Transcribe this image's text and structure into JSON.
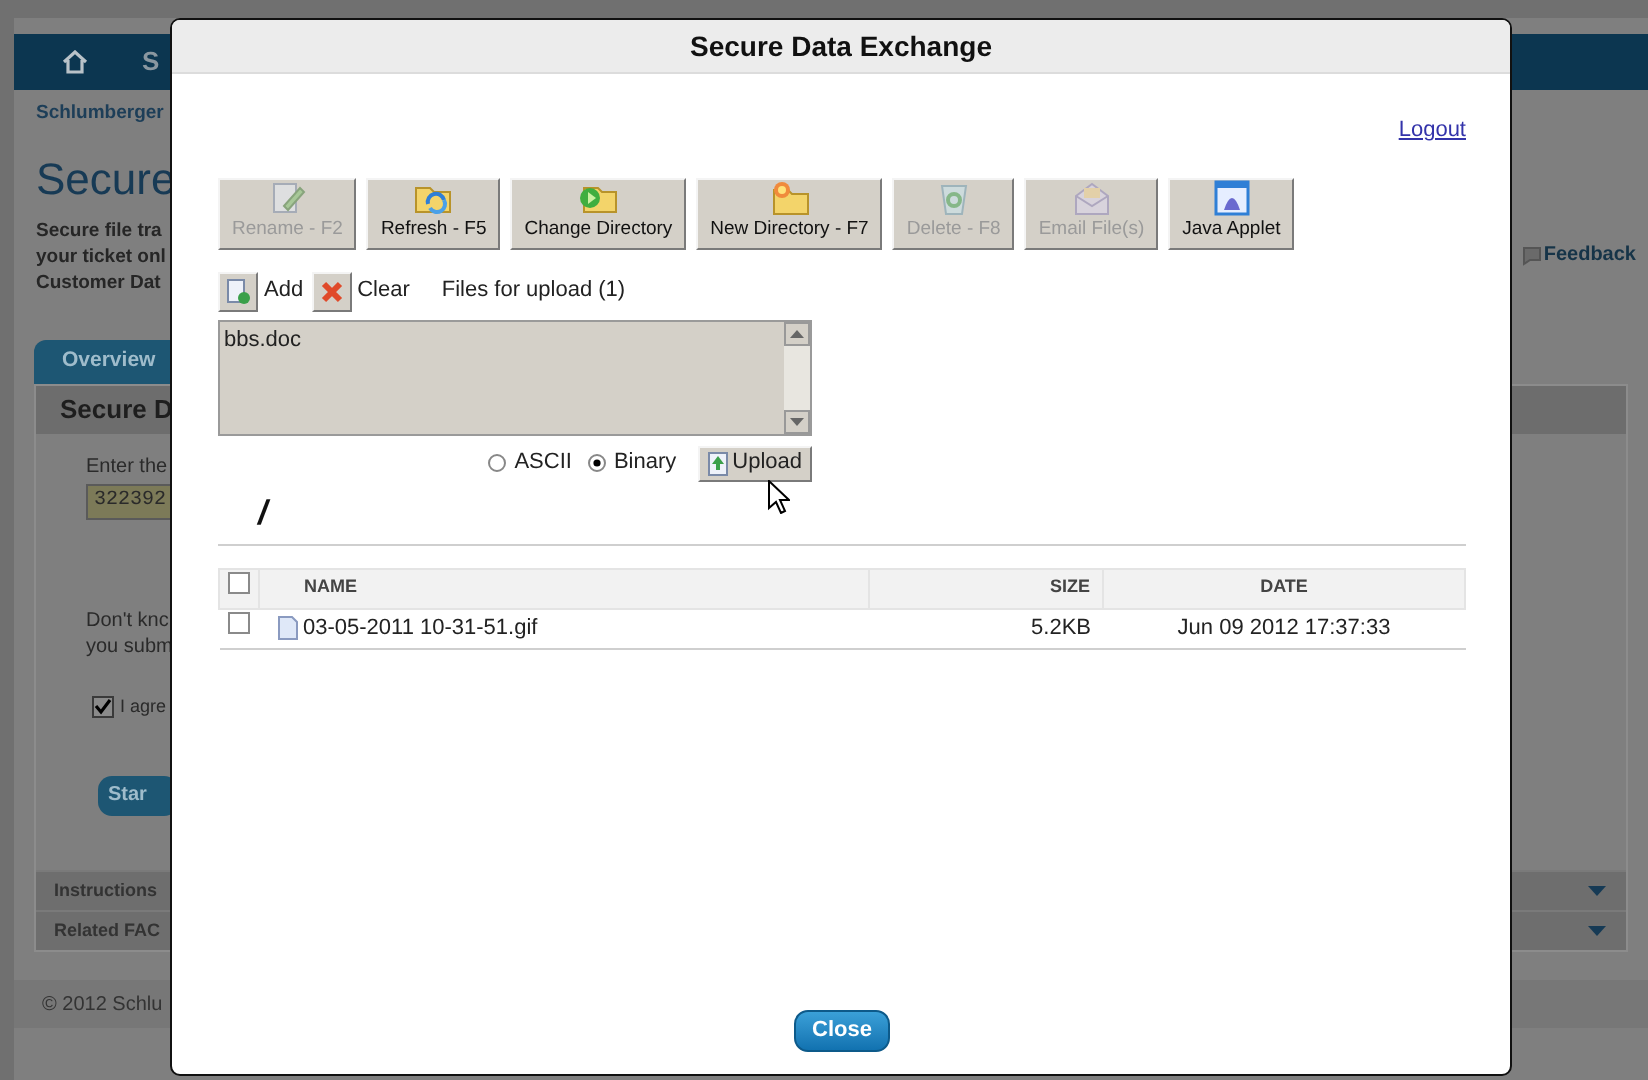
{
  "page": {
    "header_label": "S",
    "breadcrumb": "Schlumberger",
    "heading": "Secure",
    "intro_lines": [
      "Secure file tra",
      "your ticket onl",
      "Customer Dat"
    ],
    "feedback": "Feedback",
    "tabs": [
      {
        "label": "Overview",
        "selected": true
      }
    ],
    "panel_title": "Secure D",
    "field_label": "Enter the",
    "ticket_value": "322392",
    "help_lines": [
      "Don't knc",
      "you subm"
    ],
    "agree": {
      "label": "I agre",
      "checked": true
    },
    "start_button": "Star",
    "sections": [
      "Instructions",
      "Related FAC"
    ],
    "footer": "© 2012 Schlu"
  },
  "dialog": {
    "title": "Secure Data Exchange",
    "logout": "Logout",
    "toolbar": [
      {
        "kind": "rename",
        "label": "Rename - F2",
        "disabled": true
      },
      {
        "kind": "refresh",
        "label": "Refresh - F5",
        "disabled": false
      },
      {
        "kind": "change",
        "label": "Change Directory",
        "disabled": false
      },
      {
        "kind": "newdir",
        "label": "New Directory - F7",
        "disabled": false
      },
      {
        "kind": "delete",
        "label": "Delete - F8",
        "disabled": true
      },
      {
        "kind": "email",
        "label": "Email File(s)",
        "disabled": true
      },
      {
        "kind": "applet",
        "label": "Java Applet",
        "disabled": false
      }
    ],
    "upload": {
      "add": "Add",
      "clear": "Clear",
      "files_label": "Files for upload (1)",
      "files": [
        "bbs.doc"
      ],
      "modes": [
        {
          "label": "ASCII",
          "selected": false
        },
        {
          "label": "Binary",
          "selected": true
        }
      ],
      "button": "Upload"
    },
    "path": "/",
    "table": {
      "all_checked": false,
      "columns": [
        "NAME",
        "SIZE",
        "DATE"
      ],
      "rows": [
        {
          "name": "03-05-2011 10-31-51.gif",
          "size": "5.2KB",
          "date": "Jun 09 2012 17:37:33",
          "checked": false
        }
      ]
    },
    "close": "Close"
  }
}
